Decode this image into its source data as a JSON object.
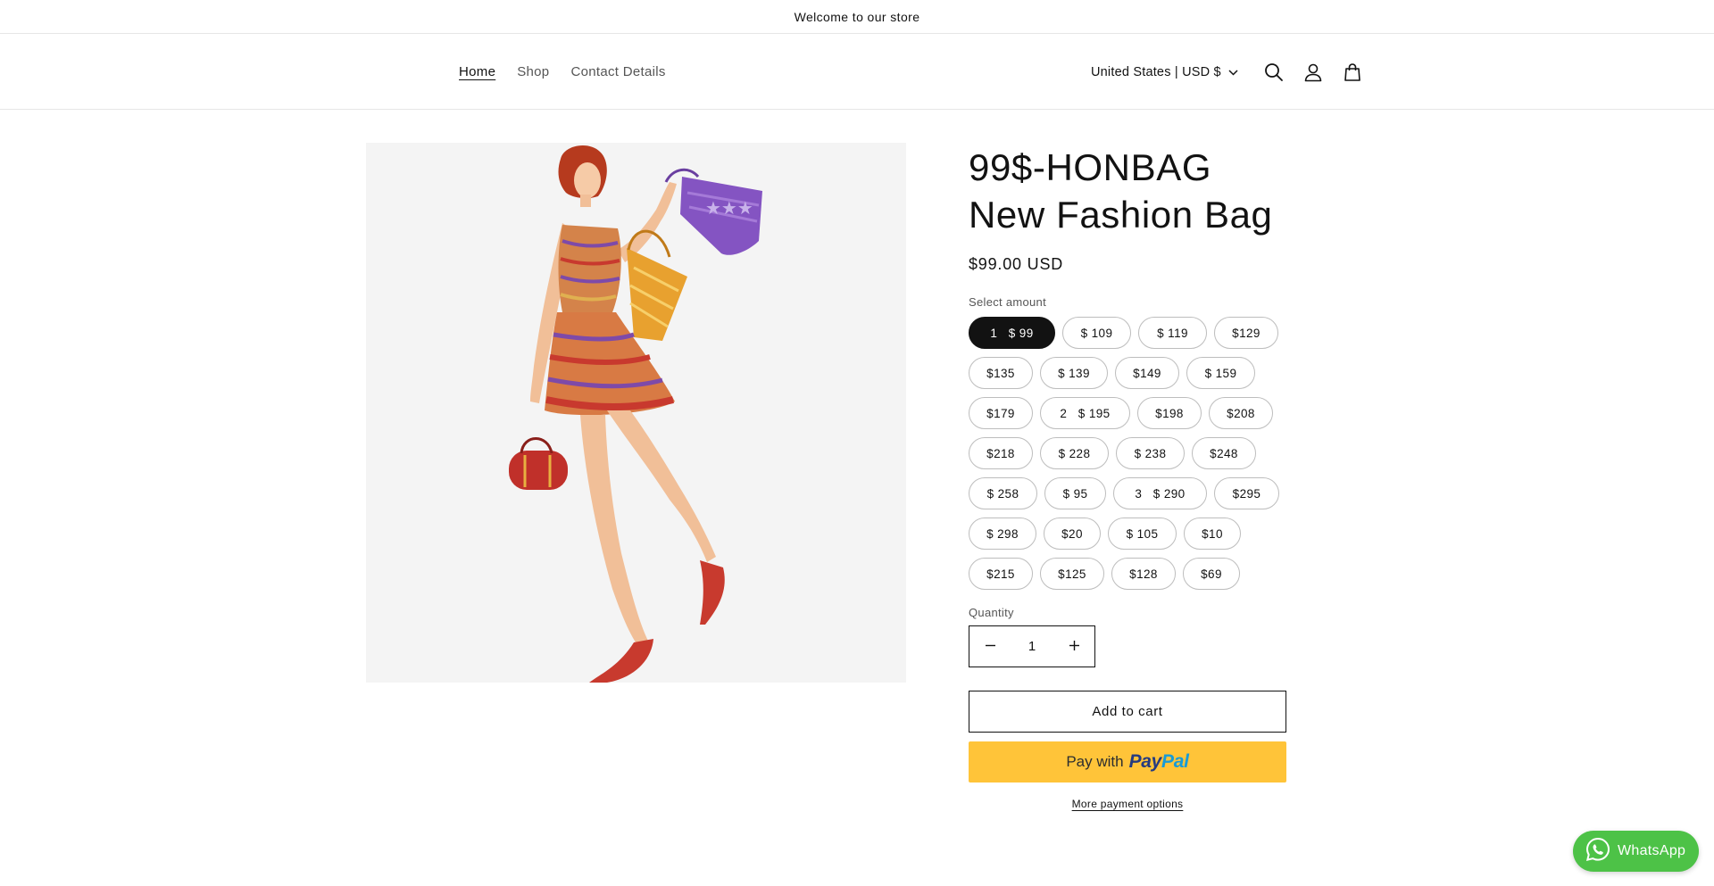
{
  "announcement": {
    "text": "Welcome to our store"
  },
  "nav": {
    "items": [
      {
        "label": "Home",
        "active": true
      },
      {
        "label": "Shop",
        "active": false
      },
      {
        "label": "Contact Details",
        "active": false
      }
    ]
  },
  "header": {
    "locale": "United States | USD $",
    "icons": [
      "search-icon",
      "account-icon",
      "cart-icon",
      "chevron-down-icon"
    ]
  },
  "product": {
    "image_icon": "fashion-woman-with-bags-illustration",
    "title": "99$-HONBAG New Fashion Bag",
    "price": "$99.00 USD",
    "amount_label": "Select amount",
    "amount_options": [
      {
        "label": "1   $ 99",
        "selected": true
      },
      {
        "label": "$ 109",
        "selected": false
      },
      {
        "label": "$ 119",
        "selected": false
      },
      {
        "label": "$129",
        "selected": false
      },
      {
        "label": "$135",
        "selected": false
      },
      {
        "label": "$ 139",
        "selected": false
      },
      {
        "label": "$149",
        "selected": false
      },
      {
        "label": "$ 159",
        "selected": false
      },
      {
        "label": "$179",
        "selected": false
      },
      {
        "label": "2   $ 195",
        "selected": false
      },
      {
        "label": "$198",
        "selected": false
      },
      {
        "label": "$208",
        "selected": false
      },
      {
        "label": "$218",
        "selected": false
      },
      {
        "label": "$ 228",
        "selected": false
      },
      {
        "label": "$ 238",
        "selected": false
      },
      {
        "label": "$248",
        "selected": false
      },
      {
        "label": "$ 258",
        "selected": false
      },
      {
        "label": "$ 95",
        "selected": false
      },
      {
        "label": "3   $ 290",
        "selected": false
      },
      {
        "label": "$295",
        "selected": false
      },
      {
        "label": "$ 298",
        "selected": false
      },
      {
        "label": "$20",
        "selected": false
      },
      {
        "label": "$ 105",
        "selected": false
      },
      {
        "label": "$10",
        "selected": false
      },
      {
        "label": "$215",
        "selected": false
      },
      {
        "label": "$125",
        "selected": false
      },
      {
        "label": "$128",
        "selected": false
      },
      {
        "label": "$69",
        "selected": false
      }
    ],
    "quantity_label": "Quantity",
    "quantity_value": "1",
    "add_to_cart": "Add to cart",
    "paypal": {
      "prefix": "Pay with",
      "brand_part1": "Pay",
      "brand_part2": "Pal"
    },
    "more_payment": "More payment options"
  },
  "whatsapp": {
    "label": "WhatsApp"
  },
  "colors": {
    "text": "#121212",
    "muted": "#555555",
    "paypal_yellow": "#ffc439",
    "paypal_dark_blue": "#253b80",
    "paypal_light_blue": "#179bd7",
    "whatsapp_green": "#4dc247",
    "image_bg": "#f4f4f4"
  }
}
